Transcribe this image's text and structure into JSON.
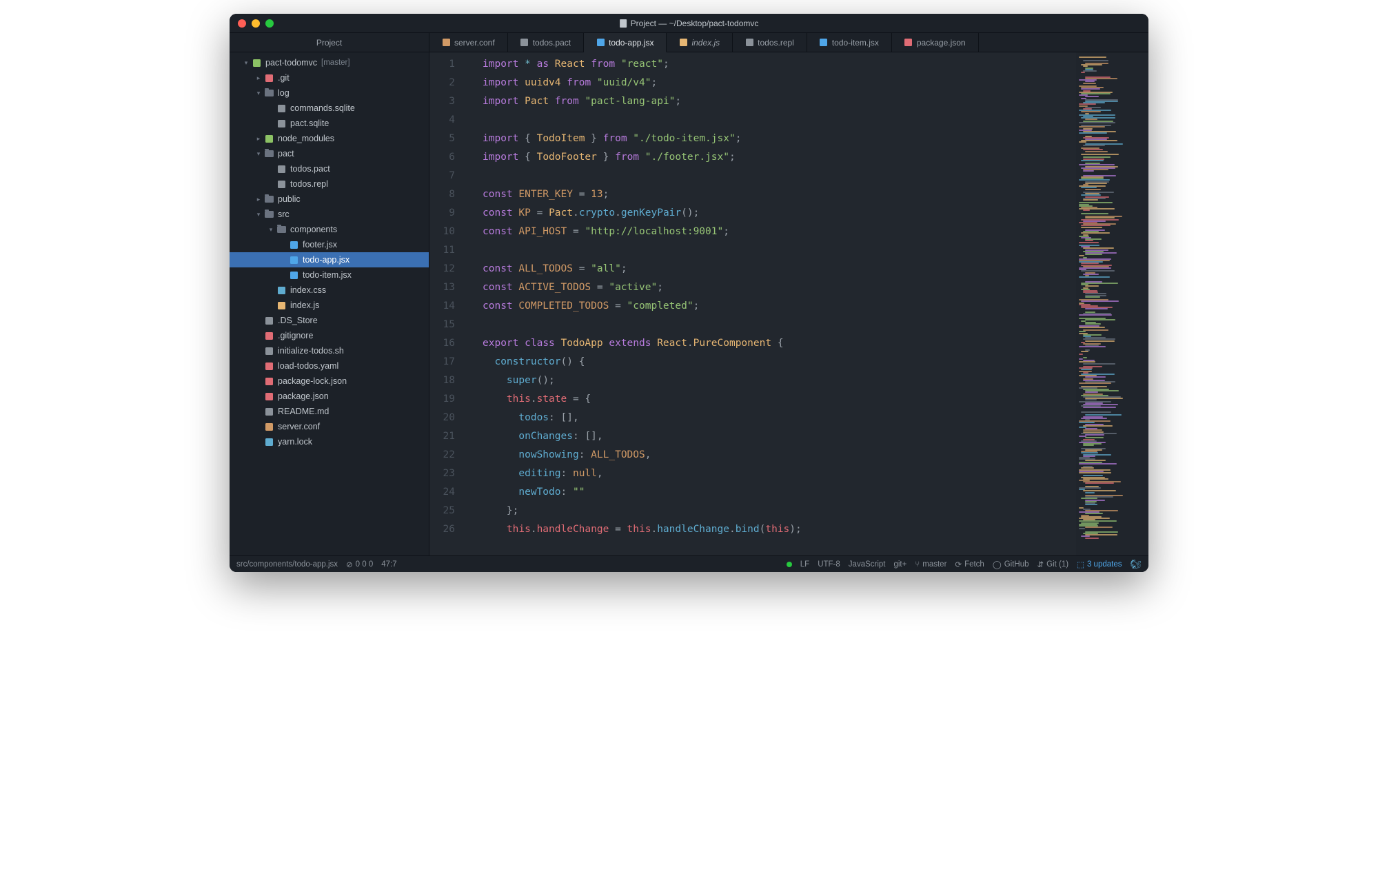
{
  "window_title": "Project — ~/Desktop/pact-todomvc",
  "sidebar": {
    "header": "Project",
    "root": {
      "label": "pact-todomvc",
      "branch": "[master]"
    },
    "tree": [
      {
        "label": ".git",
        "indent": 2,
        "chevron": "right",
        "icon": "git"
      },
      {
        "label": "log",
        "indent": 2,
        "chevron": "down",
        "icon": "folder"
      },
      {
        "label": "commands.sqlite",
        "indent": 3,
        "icon": "file"
      },
      {
        "label": "pact.sqlite",
        "indent": 3,
        "icon": "file"
      },
      {
        "label": "node_modules",
        "indent": 2,
        "chevron": "right",
        "icon": "node"
      },
      {
        "label": "pact",
        "indent": 2,
        "chevron": "down",
        "icon": "folder"
      },
      {
        "label": "todos.pact",
        "indent": 3,
        "icon": "file"
      },
      {
        "label": "todos.repl",
        "indent": 3,
        "icon": "file"
      },
      {
        "label": "public",
        "indent": 2,
        "chevron": "right",
        "icon": "folder"
      },
      {
        "label": "src",
        "indent": 2,
        "chevron": "down",
        "icon": "folder"
      },
      {
        "label": "components",
        "indent": 3,
        "chevron": "down",
        "icon": "folder"
      },
      {
        "label": "footer.jsx",
        "indent": 4,
        "icon": "jsx"
      },
      {
        "label": "todo-app.jsx",
        "indent": 4,
        "icon": "jsx",
        "selected": true
      },
      {
        "label": "todo-item.jsx",
        "indent": 4,
        "icon": "jsx"
      },
      {
        "label": "index.css",
        "indent": 3,
        "icon": "css"
      },
      {
        "label": "index.js",
        "indent": 3,
        "icon": "js"
      },
      {
        "label": ".DS_Store",
        "indent": 2,
        "icon": "ds"
      },
      {
        "label": ".gitignore",
        "indent": 2,
        "icon": "git"
      },
      {
        "label": "initialize-todos.sh",
        "indent": 2,
        "icon": "sh"
      },
      {
        "label": "load-todos.yaml",
        "indent": 2,
        "icon": "yaml"
      },
      {
        "label": "package-lock.json",
        "indent": 2,
        "icon": "json"
      },
      {
        "label": "package.json",
        "indent": 2,
        "icon": "json"
      },
      {
        "label": "README.md",
        "indent": 2,
        "icon": "md"
      },
      {
        "label": "server.conf",
        "indent": 2,
        "icon": "conf"
      },
      {
        "label": "yarn.lock",
        "indent": 2,
        "icon": "yarn"
      }
    ]
  },
  "tabs": [
    {
      "label": "server.conf",
      "icon": "conf"
    },
    {
      "label": "todos.pact",
      "icon": "file"
    },
    {
      "label": "todo-app.jsx",
      "icon": "jsx",
      "active": true
    },
    {
      "label": "index.js",
      "icon": "js",
      "italic": true
    },
    {
      "label": "todos.repl",
      "icon": "file"
    },
    {
      "label": "todo-item.jsx",
      "icon": "jsx"
    },
    {
      "label": "package.json",
      "icon": "json"
    }
  ],
  "gutter_lines": [
    "1",
    "2",
    "3",
    "4",
    "5",
    "6",
    "7",
    "8",
    "9",
    "10",
    "11",
    "12",
    "13",
    "14",
    "15",
    "16",
    "17",
    "18",
    "19",
    "20",
    "21",
    "22",
    "23",
    "24",
    "25",
    "26"
  ],
  "code_tokens": {
    "kw_import": "import",
    "star": "*",
    "kw_as": "as",
    "id_React": "React",
    "kw_from": "from",
    "str_react": "\"react\"",
    "semi": ";",
    "id_uuidv4": "uuidv4",
    "str_uuid": "\"uuid/v4\"",
    "id_Pact": "Pact",
    "str_pactapi": "\"pact-lang-api\"",
    "lbrace": "{",
    "rbrace": "}",
    "id_TodoItem": "TodoItem",
    "str_todoitem": "\"./todo-item.jsx\"",
    "id_TodoFooter": "TodoFooter",
    "str_footer": "\"./footer.jsx\"",
    "kw_const": "const",
    "id_ENTER_KEY": "ENTER_KEY",
    "eq": "=",
    "num_13": "13",
    "id_KP": "KP",
    "id_Pact2": "Pact",
    "prop_crypto": "crypto",
    "fn_genKeyPair": "genKeyPair",
    "lp": "(",
    "rp": ")",
    "id_API_HOST": "API_HOST",
    "str_localhost": "\"http://localhost:9001\"",
    "id_ALL_TODOS": "ALL_TODOS",
    "str_all": "\"all\"",
    "id_ACTIVE_TODOS": "ACTIVE_TODOS",
    "str_active": "\"active\"",
    "id_COMPLETED_TODOS": "COMPLETED_TODOS",
    "str_completed": "\"completed\"",
    "kw_export": "export",
    "kw_class": "class",
    "id_TodoApp": "TodoApp",
    "kw_extends": "extends",
    "id_React2": "React",
    "id_PureComponent": "PureComponent",
    "fn_constructor": "constructor",
    "fn_super": "super",
    "kw_this": "this",
    "prop_state": "state",
    "prop_todos": "todos",
    "lbrack": "[",
    "rbrack": "]",
    "comma": ",",
    "prop_onChanges": "onChanges",
    "prop_nowShowing": "nowShowing",
    "id_ALL_TODOS2": "ALL_TODOS",
    "prop_editing": "editing",
    "null": "null",
    "prop_newTodo": "newTodo",
    "str_empty": "\"\"",
    "prop_handleChange": "handleChange",
    "fn_bind": "bind",
    "dot": ".",
    "colon": ":"
  },
  "statusbar": {
    "path": "src/components/todo-app.jsx",
    "diag": "0   0   0",
    "cursor": "47:7",
    "lf": "LF",
    "encoding": "UTF-8",
    "lang": "JavaScript",
    "gitplus": "git+",
    "branch": "master",
    "fetch": "Fetch",
    "github": "GitHub",
    "git_count": "Git (1)",
    "updates": "3 updates"
  },
  "icon_colors": {
    "jsx": "#4fa6e8",
    "js": "#e6b673",
    "json": "#e06c75",
    "css": "#5facd0",
    "conf": "#d19a66",
    "md": "#8b929a",
    "git": "#e06c75",
    "node": "#8cc265",
    "sh": "#8b929a",
    "yaml": "#e06c75",
    "yarn": "#5facd0",
    "ds": "#8b929a",
    "file": "#8b929a",
    "folder": "#6b7380",
    "repo": "#8cc265"
  }
}
